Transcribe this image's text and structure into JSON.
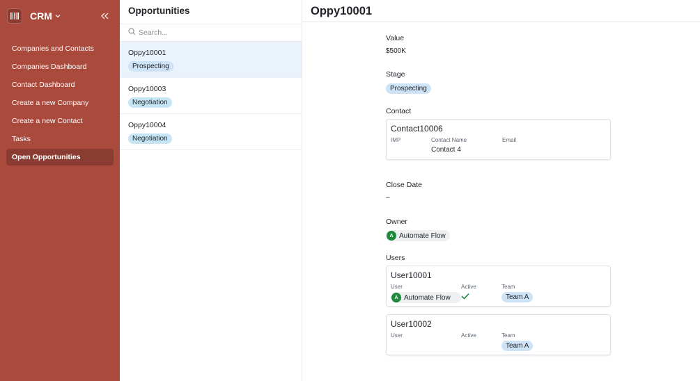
{
  "app": {
    "name": "CRM",
    "logo_icon": "app-logo-icon",
    "collapse_icon": "double-chevron-left-icon"
  },
  "sidebar": {
    "items": [
      {
        "label": "Companies and Contacts",
        "active": false
      },
      {
        "label": "Companies Dashboard",
        "active": false
      },
      {
        "label": "Contact Dashboard",
        "active": false
      },
      {
        "label": "Create a new Company",
        "active": false
      },
      {
        "label": "Create a new Contact",
        "active": false
      },
      {
        "label": "Tasks",
        "active": false
      },
      {
        "label": "Open Opportunities",
        "active": true
      }
    ]
  },
  "list": {
    "title": "Opportunities",
    "search_placeholder": "Search...",
    "items": [
      {
        "title": "Oppy10001",
        "stage": "Prospecting",
        "selected": true
      },
      {
        "title": "Oppy10003",
        "stage": "Negotiation",
        "selected": false
      },
      {
        "title": "Oppy10004",
        "stage": "Negotiation",
        "selected": false
      }
    ]
  },
  "detail": {
    "title": "Oppy10001",
    "value_label": "Value",
    "value": "$500K",
    "stage_label": "Stage",
    "stage": "Prospecting",
    "contact_label": "Contact",
    "contact": {
      "title": "Contact10006",
      "col1_label": "IMP",
      "col2_label": "Contact Name",
      "col2_value": "Contact 4",
      "col3_label": "Email"
    },
    "close_date_label": "Close Date",
    "close_date": "–",
    "owner_label": "Owner",
    "owner": {
      "initial": "A",
      "name": "Automate Flow"
    },
    "users_label": "Users",
    "users": [
      {
        "title": "User10001",
        "user_label": "User",
        "user_initial": "A",
        "user_name": "Automate Flow",
        "active_label": "Active",
        "team_label": "Team",
        "team": "Team A"
      },
      {
        "title": "User10002",
        "user_label": "User",
        "active_label": "Active",
        "team_label": "Team",
        "team": "Team A"
      }
    ]
  },
  "colors": {
    "sidebar_bg": "#a94a3d",
    "selected_row": "#eaf2fb",
    "pill_blue": "#cfe3f7",
    "avatar_green": "#1e8a3c",
    "check_green": "#1e8a3c"
  }
}
